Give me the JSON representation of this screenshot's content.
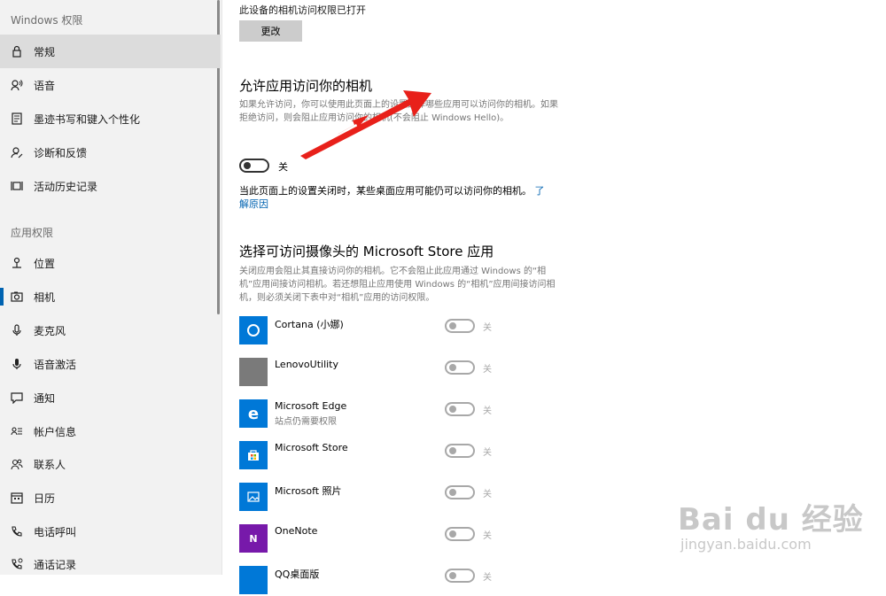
{
  "sidebar": {
    "header": "Windows 权限",
    "section_app_permissions": "应用权限",
    "items": [
      {
        "label": "常规",
        "icon": "lock-icon"
      },
      {
        "label": "语音",
        "icon": "speech-icon"
      },
      {
        "label": "墨迹书写和键入个性化",
        "icon": "ink-icon"
      },
      {
        "label": "诊断和反馈",
        "icon": "feedback-icon"
      },
      {
        "label": "活动历史记录",
        "icon": "history-icon"
      },
      {
        "label": "位置",
        "icon": "location-icon"
      },
      {
        "label": "相机",
        "icon": "camera-icon"
      },
      {
        "label": "麦克风",
        "icon": "microphone-icon"
      },
      {
        "label": "语音激活",
        "icon": "voice-activation-icon"
      },
      {
        "label": "通知",
        "icon": "notification-icon"
      },
      {
        "label": "帐户信息",
        "icon": "account-info-icon"
      },
      {
        "label": "联系人",
        "icon": "contacts-icon"
      },
      {
        "label": "日历",
        "icon": "calendar-icon"
      },
      {
        "label": "电话呼叫",
        "icon": "phone-icon"
      },
      {
        "label": "通话记录",
        "icon": "call-history-icon"
      }
    ]
  },
  "main": {
    "status_text": "此设备的相机访问权限已打开",
    "change_button": "更改",
    "allow_title": "允许应用访问你的相机",
    "allow_desc": "如果允许访问，你可以使用此页面上的设置选择哪些应用可以访问你的相机。如果拒绝访问，则会阻止应用访问你的相机(不会阻止 Windows Hello)。",
    "allow_toggle_state": "关",
    "note_text": "当此页面上的设置关闭时，某些桌面应用可能仍可以访问你的相机。",
    "note_link": "了解原因",
    "store_title": "选择可访问摄像头的 Microsoft Store 应用",
    "store_desc": "关闭应用会阻止其直接访问你的相机。它不会阻止此应用通过 Windows 的“相机”应用间接访问相机。若还想阻止应用使用 Windows 的“相机”应用间接访问相机，则必须关闭下表中对“相机”应用的访问权限。",
    "apps": [
      {
        "name": "Cortana (小娜)",
        "sub": "",
        "state": "关",
        "color": "#0078d7",
        "icon": "cortana-icon"
      },
      {
        "name": "LenovoUtility",
        "sub": "",
        "state": "关",
        "color": "#7a7a7a",
        "icon": "lenovo-utility-icon"
      },
      {
        "name": "Microsoft Edge",
        "sub": "站点仍需要权限",
        "state": "关",
        "color": "#0078d7",
        "icon": "edge-icon"
      },
      {
        "name": "Microsoft Store",
        "sub": "",
        "state": "关",
        "color": "#0078d7",
        "icon": "store-icon"
      },
      {
        "name": "Microsoft 照片",
        "sub": "",
        "state": "关",
        "color": "#0078d7",
        "icon": "photos-icon"
      },
      {
        "name": "OneNote",
        "sub": "",
        "state": "关",
        "color": "#7719aa",
        "icon": "onenote-icon"
      },
      {
        "name": "QQ桌面版",
        "sub": "",
        "state": "关",
        "color": "#0078d7",
        "icon": "qq-icon"
      }
    ]
  },
  "watermark": {
    "brand": "Bai du 经验",
    "url": "jingyan.baidu.com"
  },
  "colors": {
    "accent": "#0063b1",
    "arrow": "#e8201a"
  }
}
